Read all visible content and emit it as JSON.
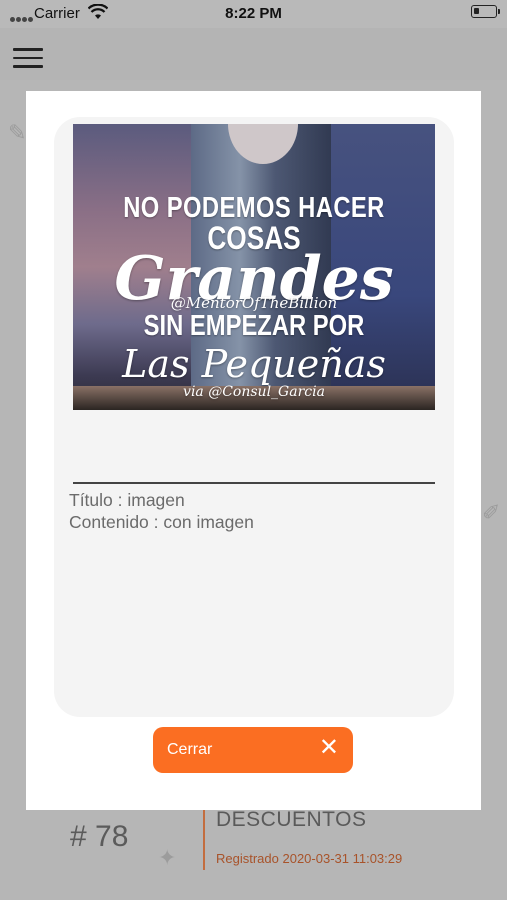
{
  "status_bar": {
    "carrier": "Carrier",
    "time": "8:22 PM"
  },
  "icons": {
    "menu": "hamburger-icon",
    "wifi": "wifi-icon",
    "battery": "battery-icon",
    "close": "close-icon"
  },
  "background_item": {
    "number": "# 78",
    "title": "DESCUENTOS",
    "registered": "Registrado  2020-03-31 11:03:29"
  },
  "modal": {
    "image_text": {
      "line1": "NO PODEMOS HACER",
      "line2": "COSAS",
      "line3": "Grandes",
      "line4": "@MentorOfTheBillion",
      "line5": "SIN EMPEZAR POR",
      "line6": "Las Pequeñas",
      "line7": "via @Consul_Garcia"
    },
    "title_line": "Título : imagen",
    "content_line": "Contenido : con imagen",
    "close_label": "Cerrar",
    "close_glyph": "✕"
  },
  "colors": {
    "accent": "#fb6e22",
    "overlay": "#b6b6b6",
    "registered_text": "#a8532a"
  }
}
